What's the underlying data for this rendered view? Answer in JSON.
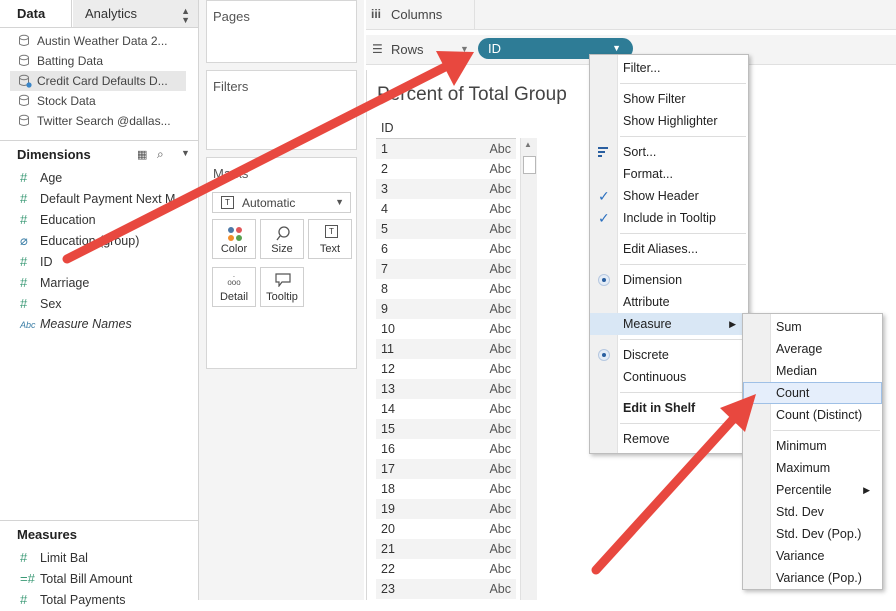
{
  "tabs": {
    "data": "Data",
    "analytics": "Analytics"
  },
  "datasources": [
    "Austin Weather Data 2...",
    "Batting Data",
    "Credit Card Defaults D...",
    "Stock Data",
    "Twitter Search @dallas..."
  ],
  "dimensions": {
    "title": "Dimensions",
    "fields": [
      {
        "label": "Age",
        "icon": "hash"
      },
      {
        "label": "Default Payment Next M",
        "icon": "hash"
      },
      {
        "label": "Education",
        "icon": "hash"
      },
      {
        "label": "Education (group)",
        "icon": "paperclip"
      },
      {
        "label": "ID",
        "icon": "hash"
      },
      {
        "label": "Marriage",
        "icon": "hash"
      },
      {
        "label": "Sex",
        "icon": "hash"
      },
      {
        "label": "Measure Names",
        "icon": "abc"
      }
    ]
  },
  "measures": {
    "title": "Measures",
    "fields": [
      {
        "label": "Limit Bal",
        "icon": "hash"
      },
      {
        "label": "Total Bill Amount",
        "icon": "hash-eq"
      },
      {
        "label": "Total Payments",
        "icon": "hash"
      }
    ]
  },
  "cards": {
    "pages": "Pages",
    "filters": "Filters",
    "marks": "Marks"
  },
  "marks": {
    "type": "Automatic",
    "buttons": [
      "Color",
      "Size",
      "Text",
      "Detail",
      "Tooltip"
    ]
  },
  "shelves": {
    "columns": "Columns",
    "rows": "Rows",
    "pill": "ID"
  },
  "view": {
    "title": "Percent of Total Group",
    "header": "ID",
    "rows": [
      "1",
      "2",
      "3",
      "4",
      "5",
      "6",
      "7",
      "8",
      "9",
      "10",
      "11",
      "12",
      "13",
      "14",
      "15",
      "16",
      "17",
      "18",
      "19",
      "20",
      "21",
      "22",
      "23"
    ],
    "cell": "Abc"
  },
  "context_menu": [
    {
      "label": "Filter..."
    },
    {
      "sep": true
    },
    {
      "label": "Show Filter"
    },
    {
      "label": "Show Highlighter"
    },
    {
      "sep": true
    },
    {
      "label": "Sort...",
      "icon": "sort"
    },
    {
      "label": "Format..."
    },
    {
      "label": "Show Header",
      "icon": "check"
    },
    {
      "label": "Include in Tooltip",
      "icon": "check"
    },
    {
      "sep": true
    },
    {
      "label": "Edit Aliases..."
    },
    {
      "sep": true
    },
    {
      "label": "Dimension",
      "icon": "radio"
    },
    {
      "label": "Attribute"
    },
    {
      "label": "Measure",
      "submenu": true,
      "highlight": true
    },
    {
      "sep": true
    },
    {
      "label": "Discrete",
      "icon": "radio"
    },
    {
      "label": "Continuous"
    },
    {
      "sep": true
    },
    {
      "label": "Edit in Shelf",
      "bold": true
    },
    {
      "sep": true
    },
    {
      "label": "Remove"
    }
  ],
  "measure_submenu": [
    {
      "label": "Sum"
    },
    {
      "label": "Average"
    },
    {
      "label": "Median"
    },
    {
      "label": "Count",
      "highlight": true
    },
    {
      "label": "Count (Distinct)"
    },
    {
      "sep": true
    },
    {
      "label": "Minimum"
    },
    {
      "label": "Maximum"
    },
    {
      "label": "Percentile",
      "submenu": true
    },
    {
      "label": "Std. Dev"
    },
    {
      "label": "Std. Dev (Pop.)"
    },
    {
      "label": "Variance"
    },
    {
      "label": "Variance (Pop.)"
    }
  ],
  "colors": {
    "pill": "#2e7c96",
    "arrow": "#e8483f",
    "accent_green": "#3b9a76"
  }
}
